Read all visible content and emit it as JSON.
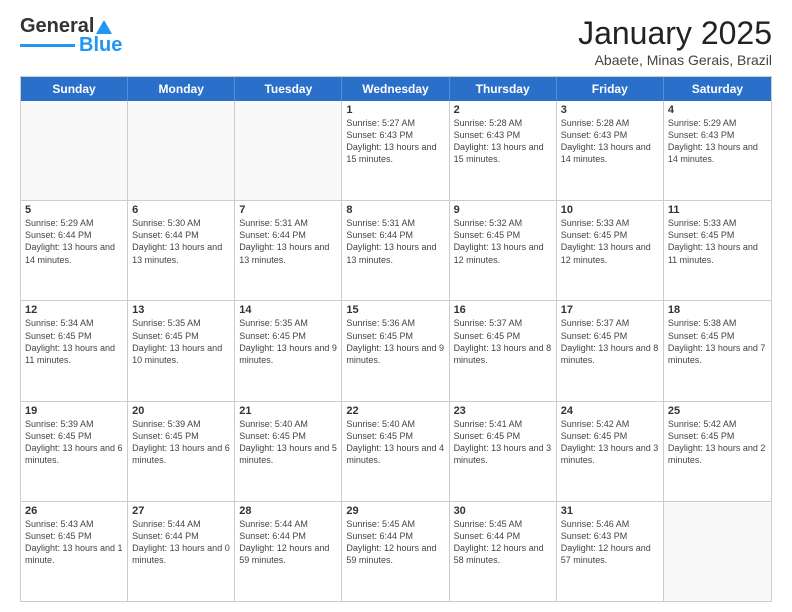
{
  "header": {
    "logo_general": "General",
    "logo_blue": "Blue",
    "title": "January 2025",
    "subtitle": "Abaete, Minas Gerais, Brazil"
  },
  "days_of_week": [
    "Sunday",
    "Monday",
    "Tuesday",
    "Wednesday",
    "Thursday",
    "Friday",
    "Saturday"
  ],
  "weeks": [
    [
      {
        "num": "",
        "info": ""
      },
      {
        "num": "",
        "info": ""
      },
      {
        "num": "",
        "info": ""
      },
      {
        "num": "1",
        "info": "Sunrise: 5:27 AM\nSunset: 6:43 PM\nDaylight: 13 hours\nand 15 minutes."
      },
      {
        "num": "2",
        "info": "Sunrise: 5:28 AM\nSunset: 6:43 PM\nDaylight: 13 hours\nand 15 minutes."
      },
      {
        "num": "3",
        "info": "Sunrise: 5:28 AM\nSunset: 6:43 PM\nDaylight: 13 hours\nand 14 minutes."
      },
      {
        "num": "4",
        "info": "Sunrise: 5:29 AM\nSunset: 6:43 PM\nDaylight: 13 hours\nand 14 minutes."
      }
    ],
    [
      {
        "num": "5",
        "info": "Sunrise: 5:29 AM\nSunset: 6:44 PM\nDaylight: 13 hours\nand 14 minutes."
      },
      {
        "num": "6",
        "info": "Sunrise: 5:30 AM\nSunset: 6:44 PM\nDaylight: 13 hours\nand 13 minutes."
      },
      {
        "num": "7",
        "info": "Sunrise: 5:31 AM\nSunset: 6:44 PM\nDaylight: 13 hours\nand 13 minutes."
      },
      {
        "num": "8",
        "info": "Sunrise: 5:31 AM\nSunset: 6:44 PM\nDaylight: 13 hours\nand 13 minutes."
      },
      {
        "num": "9",
        "info": "Sunrise: 5:32 AM\nSunset: 6:45 PM\nDaylight: 13 hours\nand 12 minutes."
      },
      {
        "num": "10",
        "info": "Sunrise: 5:33 AM\nSunset: 6:45 PM\nDaylight: 13 hours\nand 12 minutes."
      },
      {
        "num": "11",
        "info": "Sunrise: 5:33 AM\nSunset: 6:45 PM\nDaylight: 13 hours\nand 11 minutes."
      }
    ],
    [
      {
        "num": "12",
        "info": "Sunrise: 5:34 AM\nSunset: 6:45 PM\nDaylight: 13 hours\nand 11 minutes."
      },
      {
        "num": "13",
        "info": "Sunrise: 5:35 AM\nSunset: 6:45 PM\nDaylight: 13 hours\nand 10 minutes."
      },
      {
        "num": "14",
        "info": "Sunrise: 5:35 AM\nSunset: 6:45 PM\nDaylight: 13 hours\nand 9 minutes."
      },
      {
        "num": "15",
        "info": "Sunrise: 5:36 AM\nSunset: 6:45 PM\nDaylight: 13 hours\nand 9 minutes."
      },
      {
        "num": "16",
        "info": "Sunrise: 5:37 AM\nSunset: 6:45 PM\nDaylight: 13 hours\nand 8 minutes."
      },
      {
        "num": "17",
        "info": "Sunrise: 5:37 AM\nSunset: 6:45 PM\nDaylight: 13 hours\nand 8 minutes."
      },
      {
        "num": "18",
        "info": "Sunrise: 5:38 AM\nSunset: 6:45 PM\nDaylight: 13 hours\nand 7 minutes."
      }
    ],
    [
      {
        "num": "19",
        "info": "Sunrise: 5:39 AM\nSunset: 6:45 PM\nDaylight: 13 hours\nand 6 minutes."
      },
      {
        "num": "20",
        "info": "Sunrise: 5:39 AM\nSunset: 6:45 PM\nDaylight: 13 hours\nand 6 minutes."
      },
      {
        "num": "21",
        "info": "Sunrise: 5:40 AM\nSunset: 6:45 PM\nDaylight: 13 hours\nand 5 minutes."
      },
      {
        "num": "22",
        "info": "Sunrise: 5:40 AM\nSunset: 6:45 PM\nDaylight: 13 hours\nand 4 minutes."
      },
      {
        "num": "23",
        "info": "Sunrise: 5:41 AM\nSunset: 6:45 PM\nDaylight: 13 hours\nand 3 minutes."
      },
      {
        "num": "24",
        "info": "Sunrise: 5:42 AM\nSunset: 6:45 PM\nDaylight: 13 hours\nand 3 minutes."
      },
      {
        "num": "25",
        "info": "Sunrise: 5:42 AM\nSunset: 6:45 PM\nDaylight: 13 hours\nand 2 minutes."
      }
    ],
    [
      {
        "num": "26",
        "info": "Sunrise: 5:43 AM\nSunset: 6:45 PM\nDaylight: 13 hours\nand 1 minute."
      },
      {
        "num": "27",
        "info": "Sunrise: 5:44 AM\nSunset: 6:44 PM\nDaylight: 13 hours\nand 0 minutes."
      },
      {
        "num": "28",
        "info": "Sunrise: 5:44 AM\nSunset: 6:44 PM\nDaylight: 12 hours\nand 59 minutes."
      },
      {
        "num": "29",
        "info": "Sunrise: 5:45 AM\nSunset: 6:44 PM\nDaylight: 12 hours\nand 59 minutes."
      },
      {
        "num": "30",
        "info": "Sunrise: 5:45 AM\nSunset: 6:44 PM\nDaylight: 12 hours\nand 58 minutes."
      },
      {
        "num": "31",
        "info": "Sunrise: 5:46 AM\nSunset: 6:43 PM\nDaylight: 12 hours\nand 57 minutes."
      },
      {
        "num": "",
        "info": ""
      }
    ]
  ]
}
